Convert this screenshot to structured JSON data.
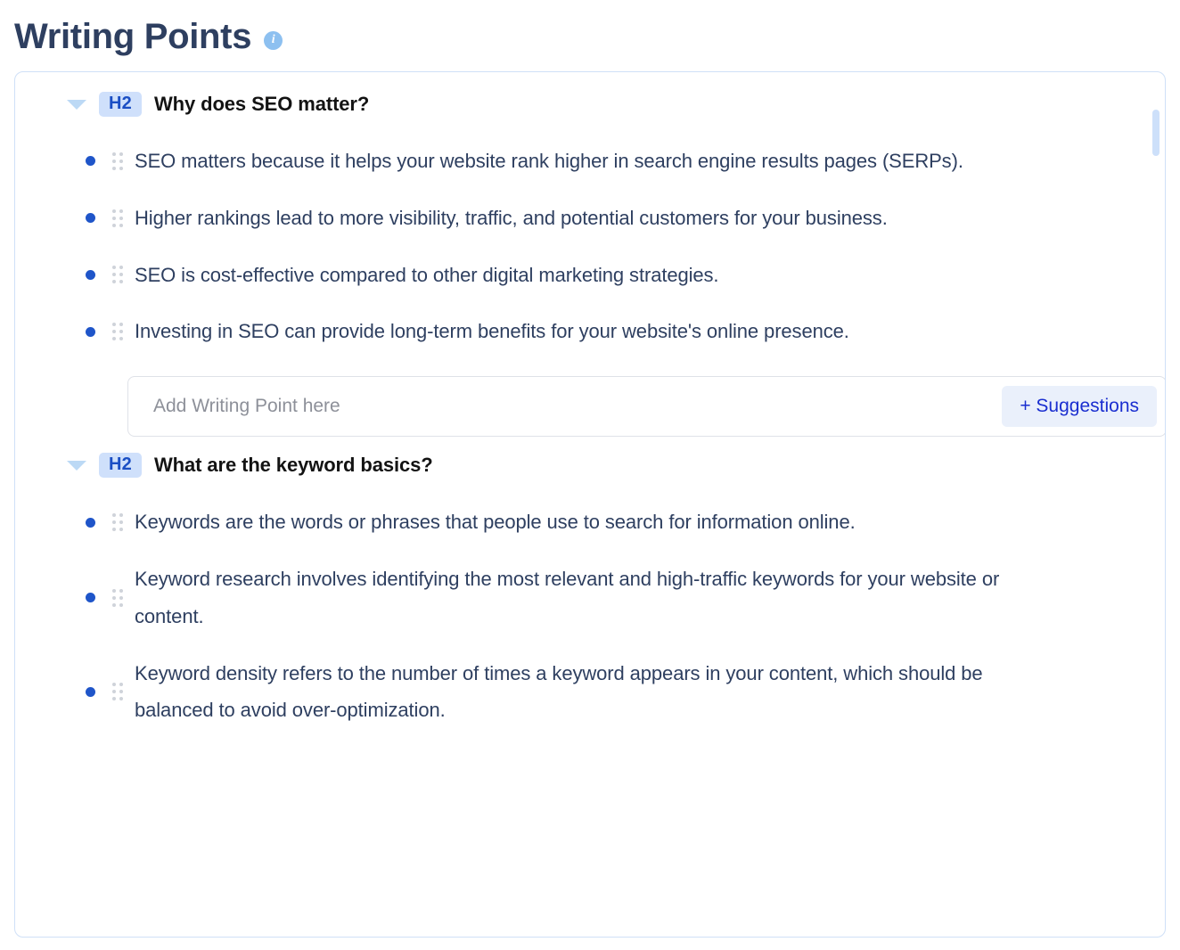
{
  "header": {
    "title": "Writing Points",
    "info_icon": "info-icon",
    "info_glyph": "i"
  },
  "theme": {
    "title_color": "#2e3f60",
    "heading_color": "#131313",
    "body_text_color": "#2e3f60",
    "badge_bg": "#cfe0fb",
    "badge_text": "#1b4fc4",
    "bullet_color": "#1f55c9",
    "panel_border": "#cfe0f7",
    "button_bg": "#eaf0fb",
    "button_text": "#1a2ed0",
    "scrollbar_thumb": "#cde0fa",
    "info_icon_bg": "#8dc0f0"
  },
  "sections": [
    {
      "level_badge": "H2",
      "heading": "Why does SEO matter?",
      "expanded": true,
      "chevron_icon": "chevron-down-icon",
      "points": [
        "SEO matters because it helps your website rank higher in search engine results pages (SERPs).",
        "Higher rankings lead to more visibility, traffic, and potential customers for your business.",
        "SEO is cost-effective compared to other digital marketing strategies.",
        "Investing in SEO can provide long-term benefits for your website's online presence."
      ],
      "add_point": {
        "placeholder": "Add Writing Point here",
        "value": "",
        "suggestions_label": "+ Suggestions"
      }
    },
    {
      "level_badge": "H2",
      "heading": "What are the keyword basics?",
      "expanded": true,
      "chevron_icon": "chevron-down-icon",
      "points": [
        "Keywords are the words or phrases that people use to search for information online.",
        "Keyword research involves identifying the most relevant and high-traffic keywords for your website or content.",
        "Keyword density refers to the number of times a keyword appears in your content, which should be balanced to avoid over-optimization."
      ]
    }
  ]
}
